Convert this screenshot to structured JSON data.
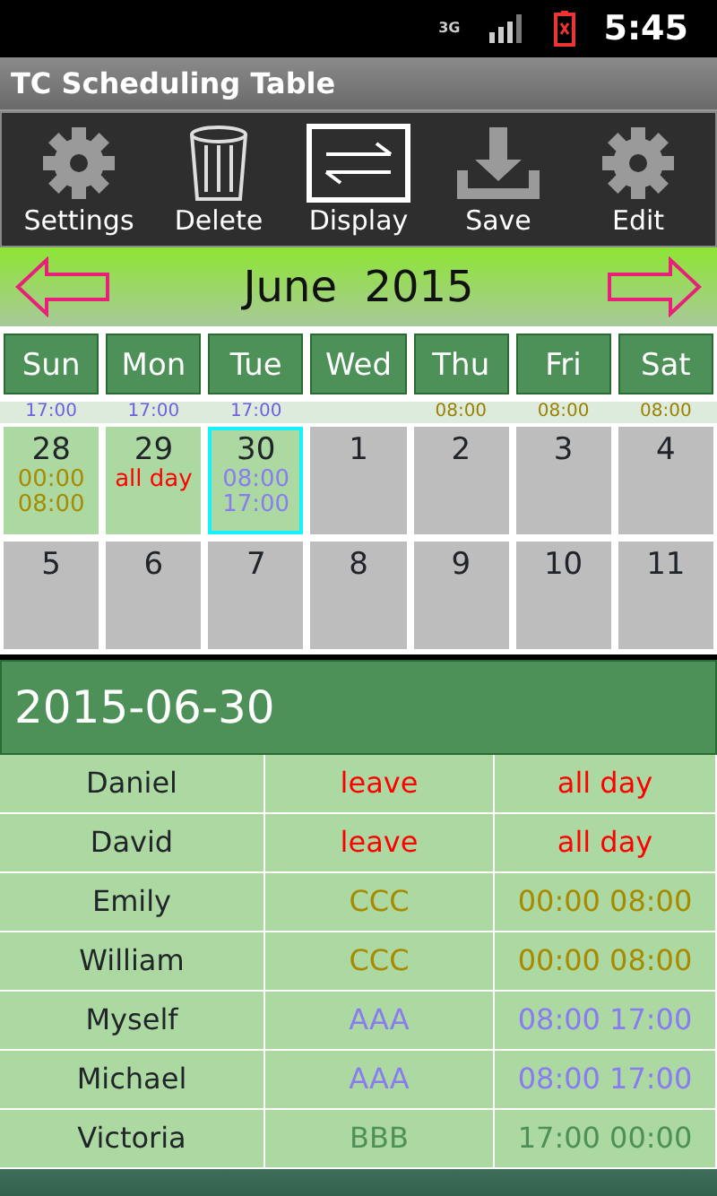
{
  "status_bar": {
    "network": "3G",
    "time": "5:45"
  },
  "window": {
    "title": "TC Scheduling Table"
  },
  "toolbar": [
    {
      "label": "Settings",
      "kind": "gear",
      "selected": false
    },
    {
      "label": "Delete",
      "kind": "trash",
      "selected": false
    },
    {
      "label": "Display",
      "kind": "swap",
      "selected": true
    },
    {
      "label": "Save",
      "kind": "download",
      "selected": false
    },
    {
      "label": "Edit",
      "kind": "gear",
      "selected": false
    }
  ],
  "calendar": {
    "month": "June  2015",
    "weekdays": [
      "Sun",
      "Mon",
      "Tue",
      "Wed",
      "Thu",
      "Fri",
      "Sat"
    ],
    "scrolled_row": [
      {
        "kind": "time",
        "text": "17:00",
        "color": "#6f5fe0"
      },
      {
        "kind": "time",
        "text": "17:00",
        "color": "#6f5fe0"
      },
      {
        "kind": "time",
        "text": "17:00",
        "color": "#6f5fe0"
      },
      {
        "kind": "blank"
      },
      {
        "kind": "time",
        "text": "08:00",
        "color": "#9a7f00"
      },
      {
        "kind": "time",
        "text": "08:00",
        "color": "#9a7f00"
      },
      {
        "kind": "time",
        "text": "08:00",
        "color": "#9a7f00"
      }
    ],
    "weeks": [
      [
        {
          "day": "28",
          "selected": false,
          "entries": [
            {
              "text": "00:00",
              "color": "#a88a00"
            },
            {
              "text": "08:00",
              "color": "#a88a00"
            }
          ]
        },
        {
          "day": "29",
          "selected": false,
          "entries": [
            {
              "text": "all day",
              "color": "#ff0000"
            }
          ]
        },
        {
          "day": "30",
          "selected": true,
          "entries": [
            {
              "text": "08:00",
              "color": "#8a7cf0"
            },
            {
              "text": "17:00",
              "color": "#8a7cf0"
            }
          ]
        },
        {
          "day": "1",
          "selected": false
        },
        {
          "day": "2",
          "selected": false
        },
        {
          "day": "3",
          "selected": false
        },
        {
          "day": "4",
          "selected": false
        }
      ],
      [
        {
          "day": "5",
          "selected": false
        },
        {
          "day": "6",
          "selected": false
        },
        {
          "day": "7",
          "selected": false
        },
        {
          "day": "8",
          "selected": false
        },
        {
          "day": "9",
          "selected": false
        },
        {
          "day": "10",
          "selected": false
        },
        {
          "day": "11",
          "selected": false
        }
      ]
    ]
  },
  "schedule": {
    "date": "2015-06-30",
    "rows": [
      {
        "name": "Daniel",
        "shift": "leave",
        "time": "all day",
        "color": "#ff0000"
      },
      {
        "name": "David",
        "shift": "leave",
        "time": "all day",
        "color": "#ff0000"
      },
      {
        "name": "Emily",
        "shift": "CCC",
        "time": "00:00 08:00",
        "color": "#a88a00"
      },
      {
        "name": "William",
        "shift": "CCC",
        "time": "00:00 08:00",
        "color": "#a88a00"
      },
      {
        "name": "Myself",
        "shift": "AAA",
        "time": "08:00 17:00",
        "color": "#8a7cf0"
      },
      {
        "name": "Michael",
        "shift": "AAA",
        "time": "08:00 17:00",
        "color": "#8a7cf0"
      },
      {
        "name": "Victoria",
        "shift": "BBB",
        "time": "17:00 00:00",
        "color": "#4e9158"
      }
    ]
  }
}
